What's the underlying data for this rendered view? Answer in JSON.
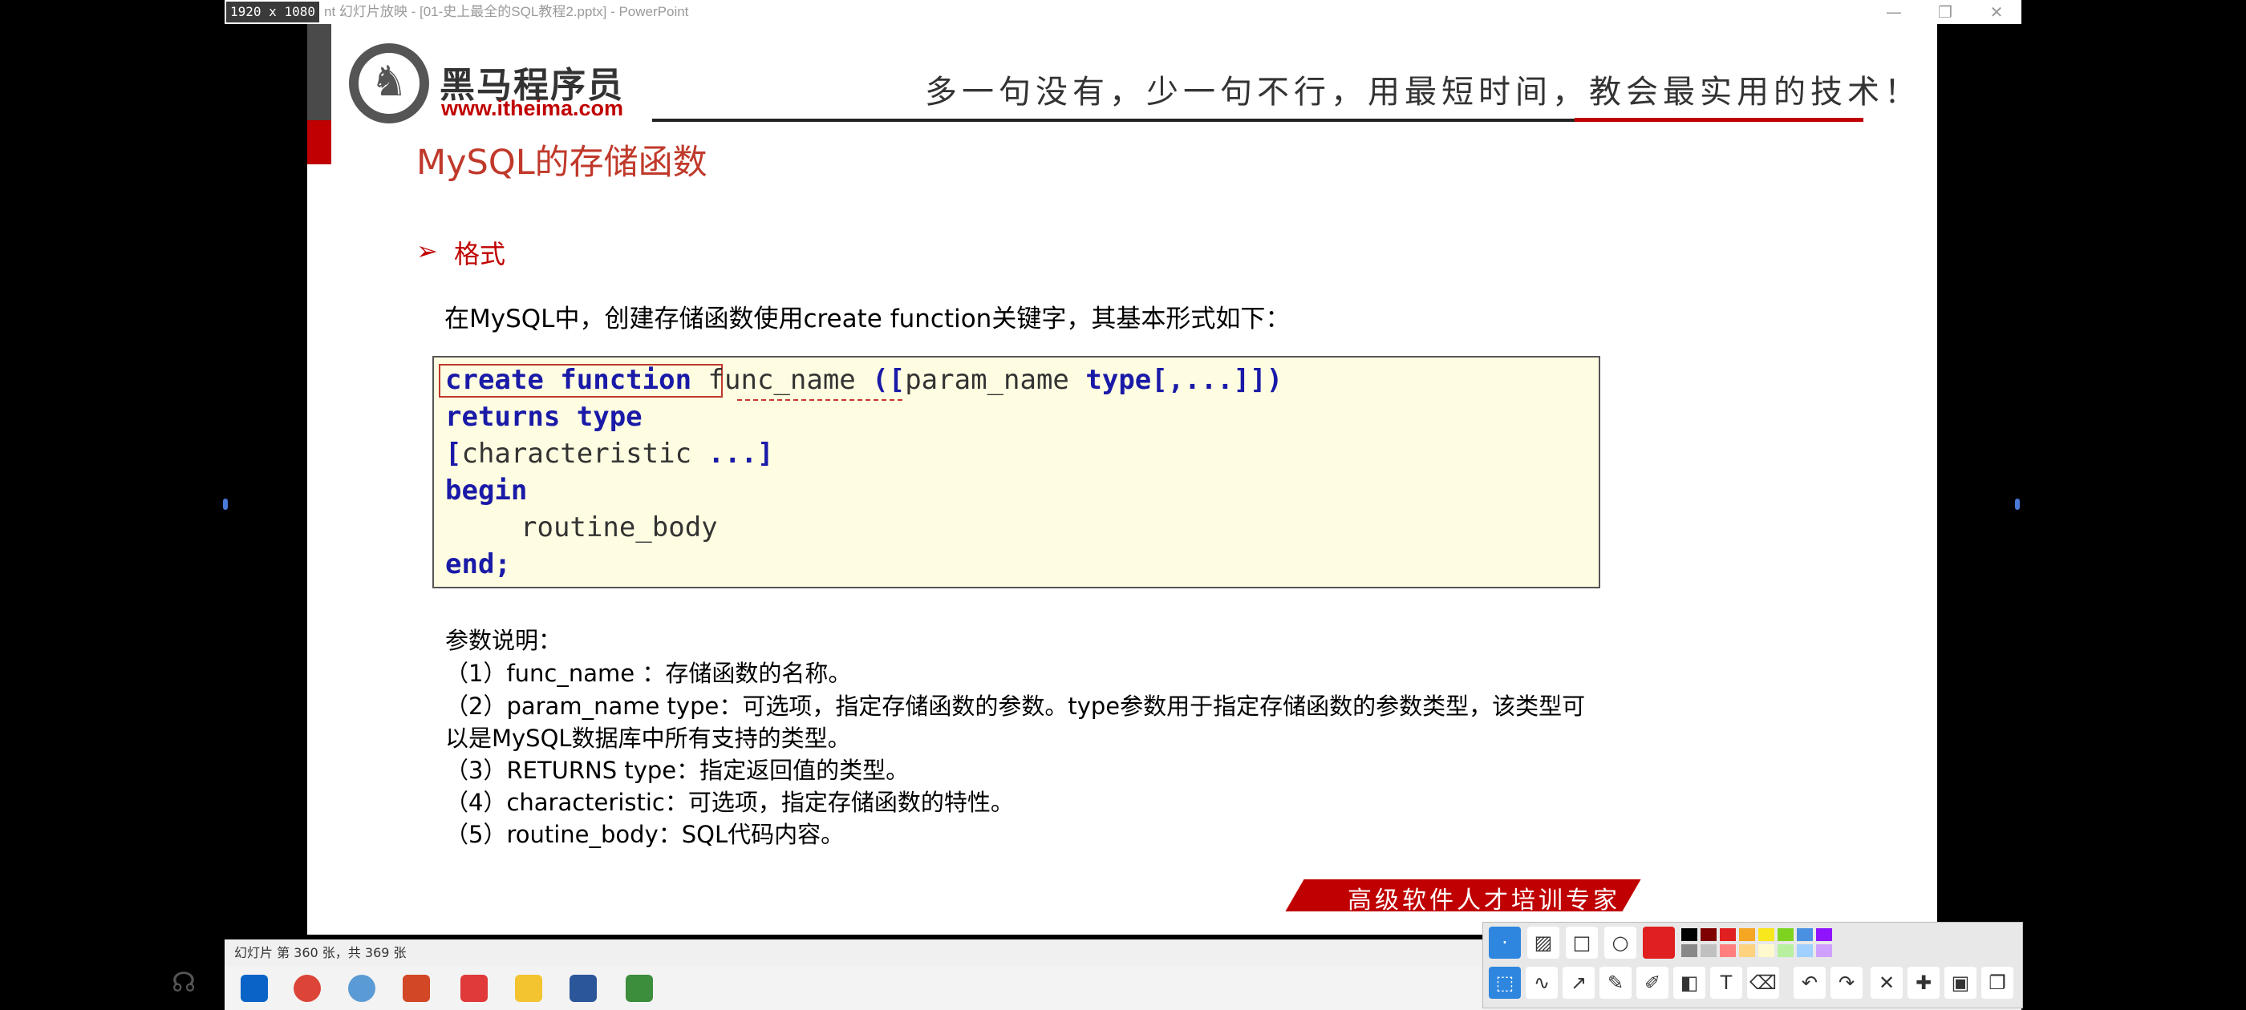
{
  "window": {
    "resolution_badge": "1920 x 1080",
    "title": "nt 幻灯片放映 - [01-史上最全的SQL教程2.pptx] - PowerPoint",
    "minimize": "—",
    "restore": "❐",
    "close": "✕"
  },
  "slide": {
    "brand_name": "黑马程序员",
    "brand_url": "www.itheima.com",
    "logo_glyph": "♞",
    "slogan": "多一句没有，少一句不行，用最短时间，教会最实用的技术！",
    "title": "MySQL的存储函数",
    "section_arrow": "➢",
    "section": "格式",
    "intro": "在MySQL中，创建存储函数使用create function关键字，其基本形式如下：",
    "code": {
      "l1_kw": "create function",
      "l1_name": "func_name",
      "l1_open": "([",
      "l1_param": "param_name",
      "l1_type": "type",
      "l1_close": "[,...]])",
      "l2_kw": "returns type",
      "l3_open": "[",
      "l3_mid": "characteristic",
      "l3_close": " ...]",
      "l4_kw": "begin",
      "l5_body": "routine_body",
      "l6_kw": "end;"
    },
    "notes": [
      "参数说明：",
      "（1）func_name ：存储函数的名称。",
      "（2）param_name type：可选项，指定存储函数的参数。type参数用于指定存储函数的参数类型，该类型可",
      "以是MySQL数据库中所有支持的类型。",
      "（3）RETURNS type：指定返回值的类型。",
      "（4）characteristic：可选项，指定存储函数的特性。",
      "（5）routine_body：SQL代码内容。"
    ],
    "banner": "高级软件人才培训专家"
  },
  "status": {
    "slide_counter": "幻灯片 第 360 张，共 369 张"
  },
  "colors": {
    "brand_red": "#c00000",
    "code_bg": "#fffde1",
    "keyword_blue": "#1a1aa8"
  },
  "toolbar": {
    "icons": [
      "dot-icon",
      "hatch-icon",
      "rectangle-icon",
      "ellipse-icon",
      "pen-color-icon",
      "select-icon",
      "line-icon",
      "arrow-icon",
      "pencil-icon",
      "highlighter-icon",
      "fill-icon",
      "text-icon",
      "eraser-icon",
      "undo-icon",
      "redo-icon",
      "close-icon",
      "pin-icon",
      "save-icon",
      "copy-icon"
    ],
    "text_tool": "T"
  }
}
